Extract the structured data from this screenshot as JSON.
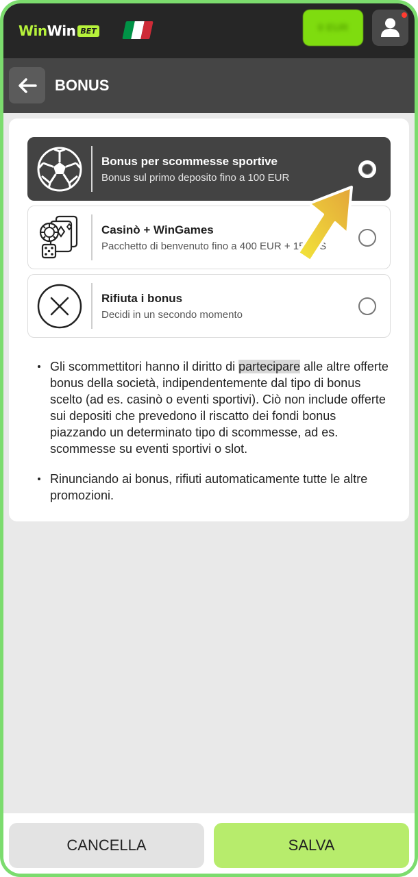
{
  "header": {
    "logo_part1": "Win",
    "logo_part2": "Win",
    "logo_badge": "BET",
    "balance_label": "0 EUR",
    "flag_colors": [
      "#009246",
      "#ffffff",
      "#ce2b37"
    ]
  },
  "subheader": {
    "title": "BONUS"
  },
  "options": [
    {
      "title": "Bonus per scommesse sportive",
      "subtitle": "Bonus sul primo deposito fino a 100 EUR",
      "icon": "soccer-ball-icon",
      "selected": true
    },
    {
      "title": "Casinò + WinGames",
      "subtitle": "Pacchetto di benvenuto fino a 400 EUR + 150 FS",
      "icon": "casino-chips-cards-dice-icon",
      "selected": false
    },
    {
      "title": "Rifiuta i bonus",
      "subtitle": "Decidi in un secondo momento",
      "icon": "close-circle-icon",
      "selected": false
    }
  ],
  "notes": {
    "note1_before": "Gli scommettitori hanno il diritto di ",
    "note1_highlight": "partecipare",
    "note1_after": " alle altre offerte bonus della società, indipendentemente dal tipo di bonus scelto (ad es. casinò o eventi sportivi). Ciò non include offerte sui depositi che prevedono il riscatto dei fondi bonus piazzando un determinato tipo di scommesse, ad es. scommesse su eventi sportivi o slot.",
    "note2": "Rinunciando ai bonus, rifiuti automaticamente tutte le altre promozioni."
  },
  "footer": {
    "cancel_label": "CANCELLA",
    "save_label": "SALVA"
  },
  "colors": {
    "accent": "#b7ec6c",
    "frame": "#7cdc6e",
    "header_bg": "#262626",
    "selected_option_bg": "#434343"
  }
}
